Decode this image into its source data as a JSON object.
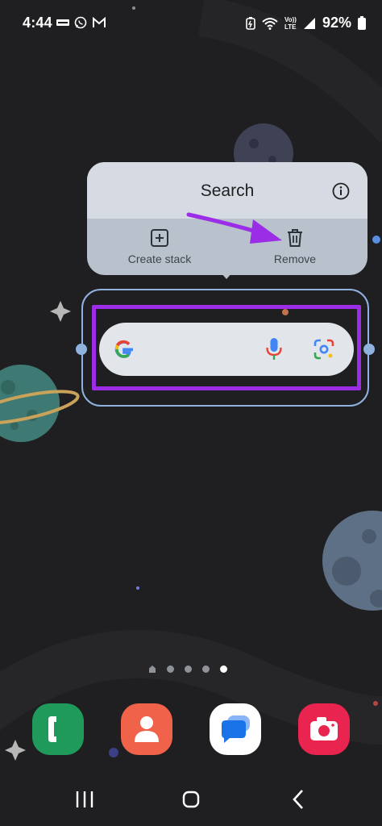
{
  "status_bar": {
    "time": "4:44",
    "left_icons": [
      "news-badge-icon",
      "whatsapp-icon",
      "gmail-icon"
    ],
    "right_icons": [
      "battery-saver-icon",
      "wifi-icon",
      "volte-icon",
      "signal-icon",
      "battery-icon"
    ],
    "volte_label_top": "Vo))",
    "volte_label_bottom": "LTE",
    "battery_percent": "92%"
  },
  "popup": {
    "title": "Search",
    "info_icon": "info-icon",
    "actions": [
      {
        "label": "Create stack",
        "icon": "plus-square-icon"
      },
      {
        "label": "Remove",
        "icon": "trash-icon"
      }
    ]
  },
  "widget": {
    "name": "Google search bar",
    "icons": [
      "google-g-logo",
      "microphone-icon",
      "google-lens-icon"
    ]
  },
  "home": {
    "page_count": 5,
    "active_page": 5
  },
  "dock": {
    "apps": [
      {
        "name": "Phone",
        "icon": "phone-icon",
        "color": "#1f9a5a"
      },
      {
        "name": "Contacts",
        "icon": "contact-icon",
        "color": "#f0624a"
      },
      {
        "name": "Messages",
        "icon": "messages-icon",
        "color": "#ffffff"
      },
      {
        "name": "Camera",
        "icon": "camera-icon",
        "color": "#e8244f"
      }
    ]
  },
  "navigation": [
    "recents-button",
    "home-button",
    "back-button"
  ],
  "colors": {
    "background": "#1f1f21",
    "highlight": "#9b2de6",
    "widget_frame": "#8fb2de",
    "arrow": "#9b2de6"
  }
}
